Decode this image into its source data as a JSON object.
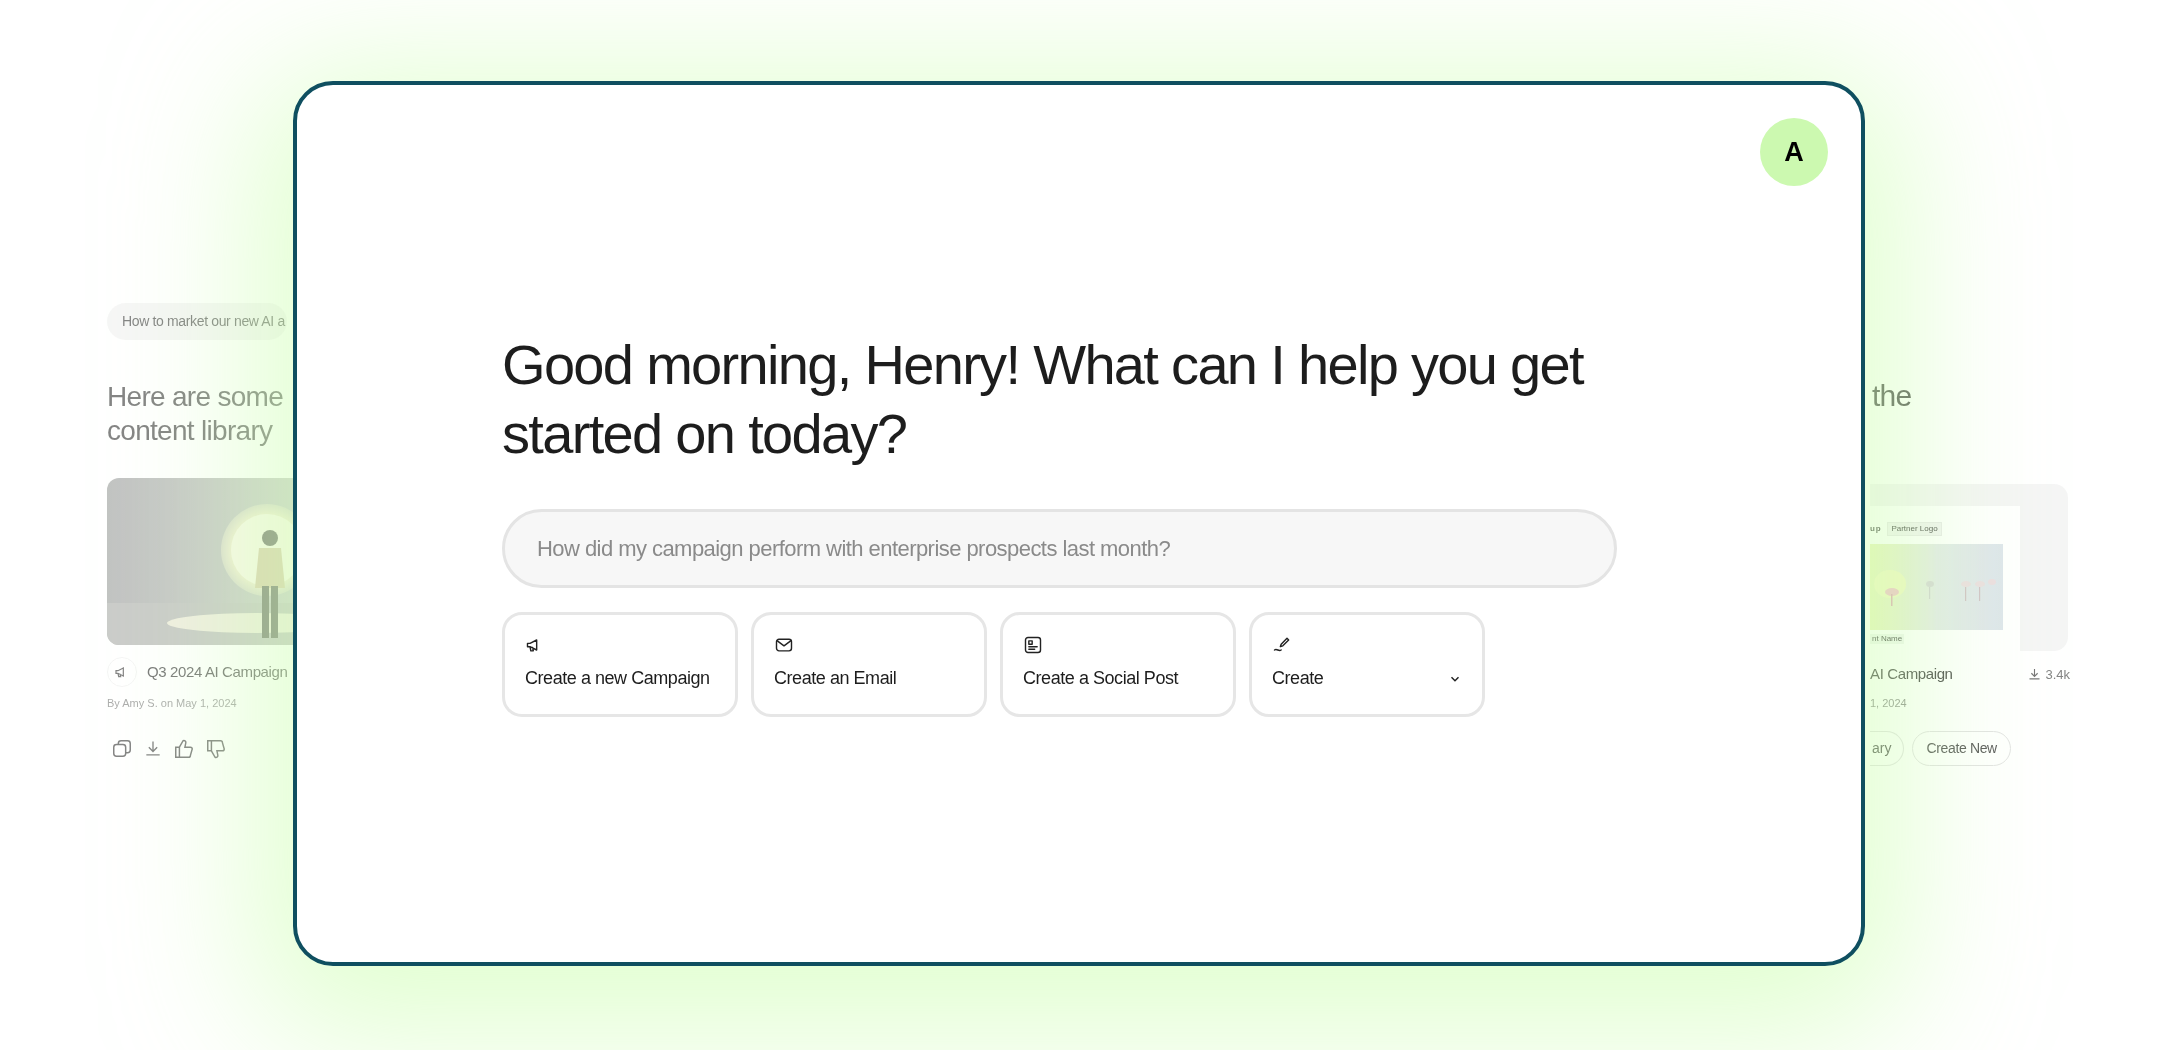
{
  "background_left": {
    "prompt_chip": "How to market our new AI a",
    "heading_lines": [
      "Here are some",
      "content library"
    ],
    "card": {
      "kind": "picture",
      "title": "Q3 2024 AI Campaign",
      "byline": "By Amy S. on May 1, 2024"
    }
  },
  "background_right": {
    "heading": "the",
    "card": {
      "logo_text": "up",
      "tag": "Partner Logo",
      "footer_tag": "nt Name",
      "title": "AI Campaign",
      "downloads": "3.4k",
      "date": "1, 2024"
    },
    "buttons": [
      "ary",
      "Create New"
    ]
  },
  "main": {
    "avatar": "A",
    "greeting": "Good morning, Henry! What can I help you get started on today?",
    "search": {
      "placeholder": "How did my campaign perform with enterprise prospects last month?"
    },
    "actions": [
      {
        "kind": "campaign",
        "label": "Create a new Campaign"
      },
      {
        "kind": "email",
        "label": "Create an Email"
      },
      {
        "kind": "social",
        "label": "Create a Social Post"
      },
      {
        "kind": "create",
        "label": "Create"
      }
    ]
  }
}
